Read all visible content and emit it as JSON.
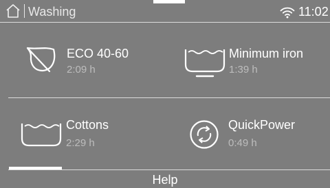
{
  "status": {
    "title": "Washing",
    "time": "11:02",
    "home_icon": "home-icon",
    "wifi_icon": "wifi-icon"
  },
  "programs": [
    {
      "name": "ECO 40-60",
      "duration": "2:09 h",
      "icon": "leaf-icon"
    },
    {
      "name": "Minimum iron",
      "duration": "1:39 h",
      "icon": "tub-minimum-iron-icon"
    },
    {
      "name": "Cottons",
      "duration": "2:29 h",
      "icon": "tub-icon"
    },
    {
      "name": "QuickPower",
      "duration": "0:49 h",
      "icon": "quickpower-icon"
    }
  ],
  "footer": {
    "help_label": "Help"
  },
  "colors": {
    "background": "#7d7d7d",
    "text": "#ffffff",
    "secondary_text": "#bdbdbd",
    "divider": "#dcdcdc"
  }
}
